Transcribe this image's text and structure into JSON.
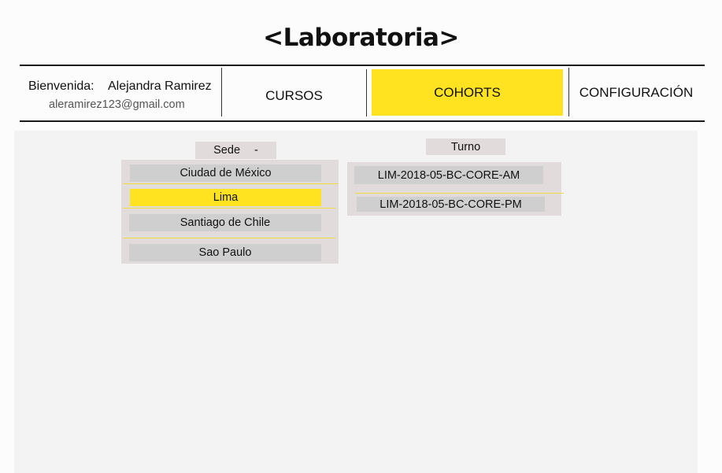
{
  "header": {
    "logo": "<Laboratoria>",
    "welcome_label": "Bienvenida:",
    "user_name": "Alejandra Ramirez",
    "user_email": "aleramirez123@gmail.com"
  },
  "nav": {
    "items": [
      {
        "label": "CURSOS",
        "active": false
      },
      {
        "label": "COHORTS",
        "active": true
      },
      {
        "label": "CONFIGURACIÓN",
        "active": false
      }
    ]
  },
  "sede": {
    "header": "Sede",
    "header_suffix": "-",
    "options": [
      "Ciudad de México",
      "Lima",
      "Santiago de Chile",
      "Sao Paulo"
    ],
    "selected": "Lima"
  },
  "turno": {
    "header": "Turno",
    "options": [
      "LIM-2018-05-BC-CORE-AM",
      "LIM-2018-05-BC-CORE-PM"
    ]
  },
  "colors": {
    "accent": "#ffe320",
    "panel_bg": "#f3f3f3",
    "box_bg": "#e2dbdb",
    "item_bg": "#cfcfcf"
  }
}
